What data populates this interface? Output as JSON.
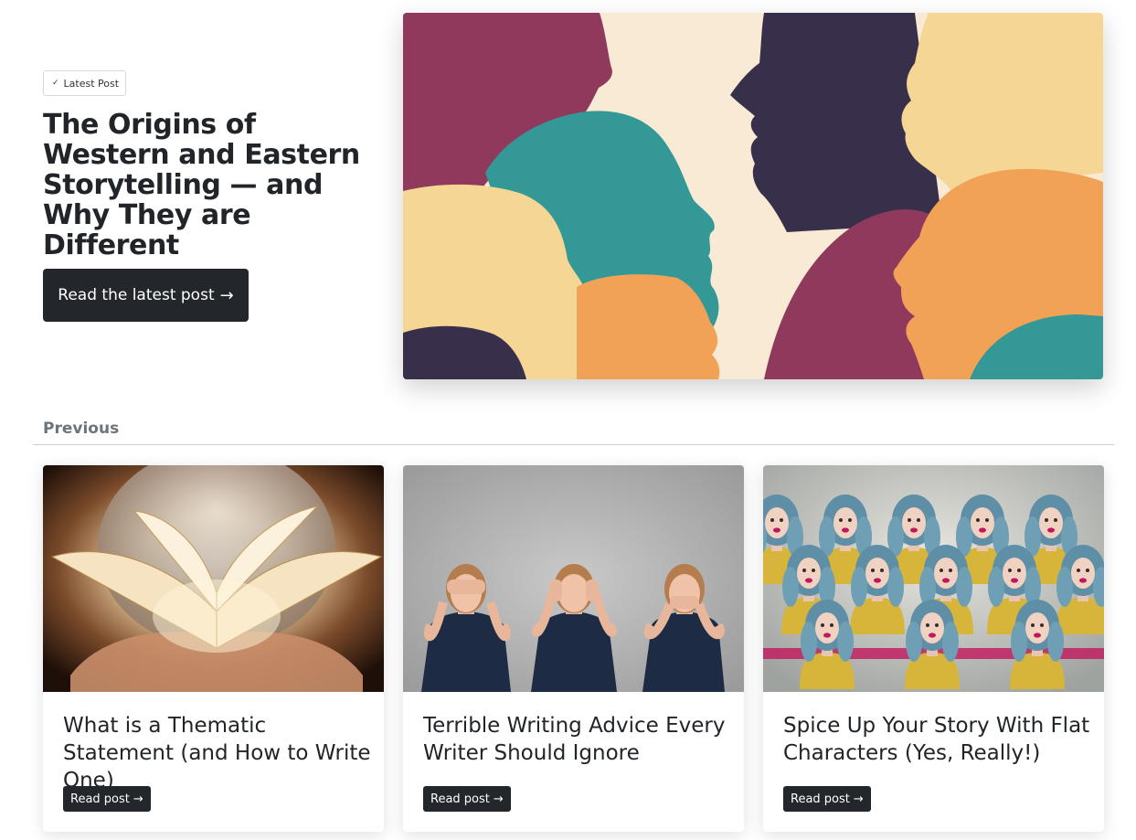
{
  "hero": {
    "badge_label": "Latest Post",
    "title": "The Origins of Western and Eastern Storytelling — and Why They are Different",
    "button_label": "Read the latest post",
    "button_arrow": "→"
  },
  "previous": {
    "heading": "Previous",
    "posts": [
      {
        "title": "What is a Thematic Statement (and How to Write One)",
        "button_label": "Read post",
        "button_arrow": "→"
      },
      {
        "title": "Terrible Writing Advice Every Writer Should Ignore",
        "button_label": "Read post",
        "button_arrow": "→"
      },
      {
        "title": "Spice Up Your Story With Flat Characters (Yes, Really!)",
        "button_label": "Read post",
        "button_arrow": "→"
      }
    ]
  },
  "colors": {
    "button_bg": "#23272b",
    "cream": "#f8ead5",
    "plum": "#8f3a5c",
    "teal": "#349996",
    "navy": "#38304b",
    "sand": "#f5d695",
    "orange": "#f1a256"
  }
}
